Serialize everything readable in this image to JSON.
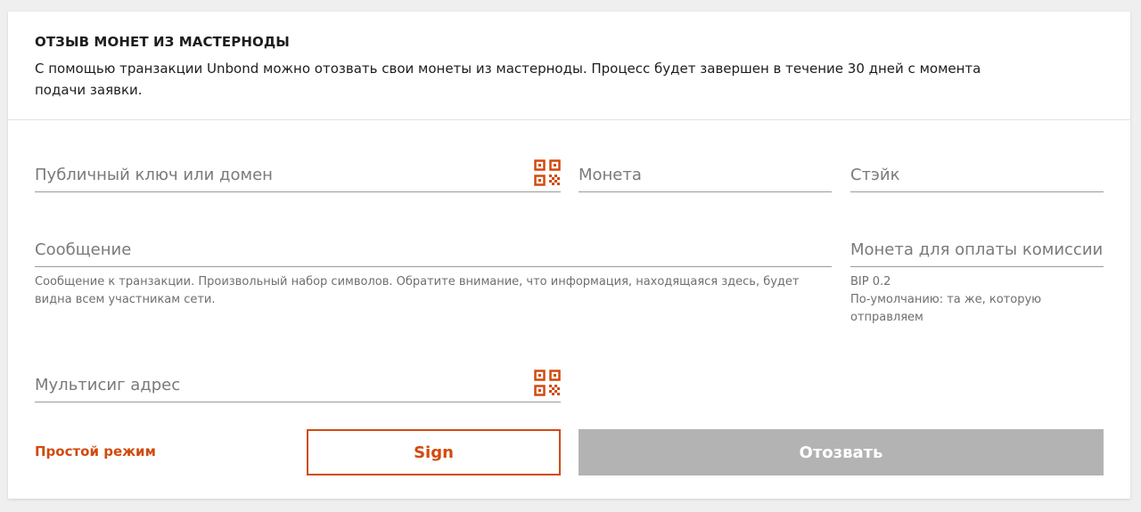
{
  "header": {
    "title": "ОТЗЫВ МОНЕТ ИЗ МАСТЕРНОДЫ",
    "description": "С помощью транзакции Unbond можно отозвать свои монеты из мастерноды. Процесс будет завершен в течение 30 дней с момента подачи заявки."
  },
  "form": {
    "public_key": {
      "placeholder": "Публичный ключ или домен",
      "icon": "qr-code-icon"
    },
    "coin": {
      "placeholder": "Монета"
    },
    "stake": {
      "placeholder": "Стэйк"
    },
    "message": {
      "placeholder": "Сообщение",
      "help": "Сообщение к транзакции. Произвольный набор символов. Обратите внимание, что информация, находящаяся здесь, будет видна всем участникам сети."
    },
    "fee_coin": {
      "placeholder": "Монета для оплаты комиссии",
      "help_value": "BIP 0.2",
      "help": "По-умолчанию: та же, которую отправляем"
    },
    "multisig": {
      "placeholder": "Мультисиг адрес",
      "icon": "qr-code-icon"
    }
  },
  "actions": {
    "simple_mode": "Простой режим",
    "sign": "Sign",
    "submit": "Отозвать"
  },
  "colors": {
    "accent": "#d24a0d",
    "disabled_button": "#b3b3b3",
    "placeholder": "#7a7a7a"
  }
}
